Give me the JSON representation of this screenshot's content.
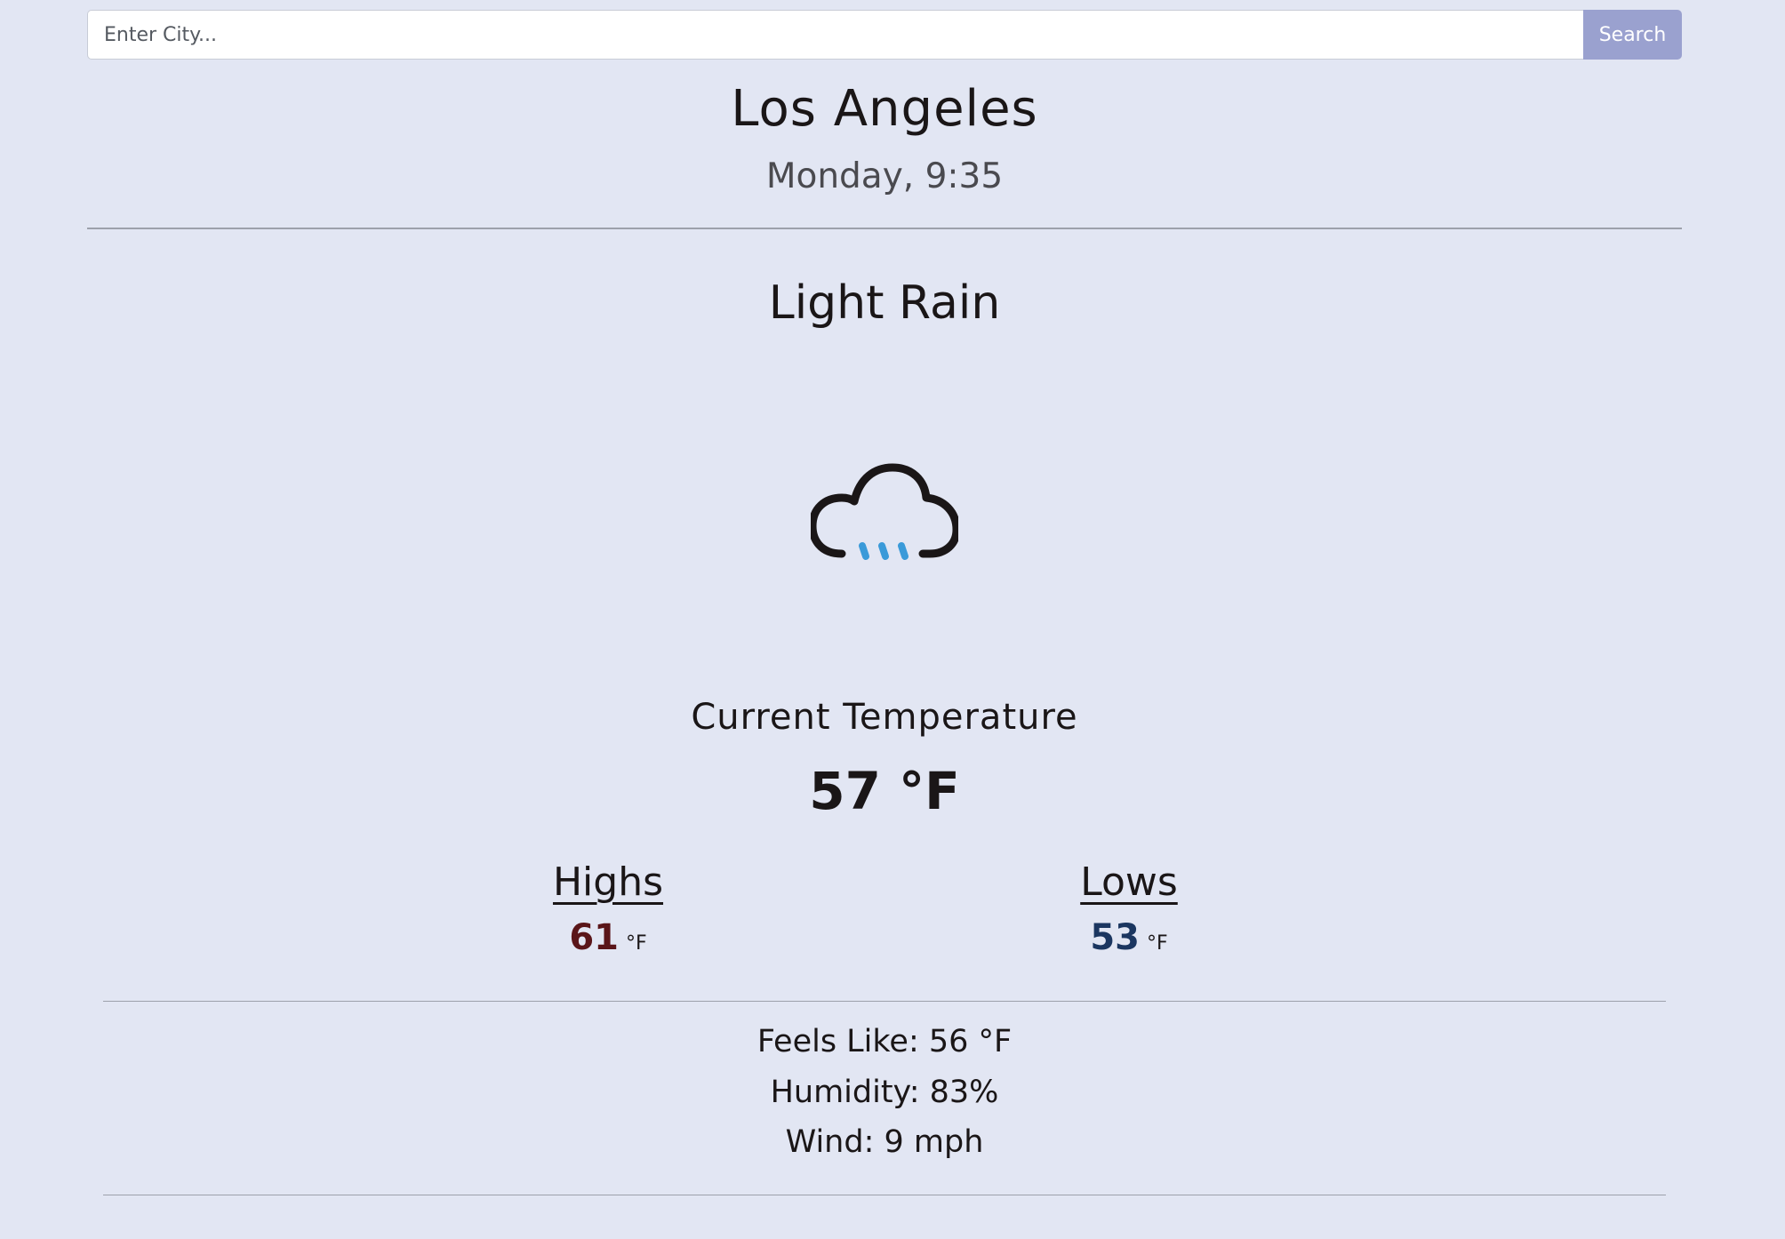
{
  "search": {
    "placeholder": "Enter City...",
    "button_label": "Search"
  },
  "location": {
    "city": "Los Angeles",
    "datetime": "Monday, 9:35"
  },
  "weather": {
    "condition": "Light Rain",
    "icon": "cloud-rain-icon"
  },
  "current": {
    "label": "Current Temperature",
    "temperature": "57 °F"
  },
  "highs": {
    "label": "Highs",
    "value": "61",
    "unit": "°F"
  },
  "lows": {
    "label": "Lows",
    "value": "53",
    "unit": "°F"
  },
  "details": {
    "feels_like": "Feels Like: 56 °F",
    "humidity": "Humidity: 83%",
    "wind": "Wind: 9 mph"
  },
  "colors": {
    "background": "#e2e6f3",
    "search_button": "#9aa1cf",
    "high_temp": "#5a1519",
    "low_temp": "#1b3660",
    "rain": "#3a9ad9"
  }
}
